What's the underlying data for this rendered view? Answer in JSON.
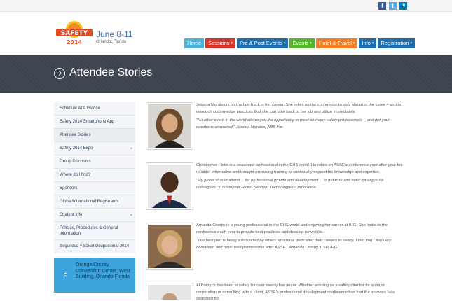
{
  "colors": {
    "nav_blue": "#1f6fae",
    "nav_teal": "#4fb0d8",
    "nav_red": "#d8342c",
    "nav_green": "#55b52e",
    "nav_orange": "#ef7d29",
    "banner": "#3c434d",
    "location_box": "#3ba3dc"
  },
  "social": {
    "items": [
      {
        "name": "facebook-icon",
        "glyph": "f",
        "color": "#3b5998"
      },
      {
        "name": "twitter-icon",
        "glyph": "t",
        "color": "#55acee"
      },
      {
        "name": "linkedin-icon",
        "glyph": "in",
        "color": "#0077b5"
      }
    ]
  },
  "header": {
    "logo_text": "SAFETY",
    "logo_year": "2014",
    "date": "June 8-11",
    "location": "Orlando, Florida"
  },
  "nav": {
    "items": [
      {
        "label": "Home",
        "has_menu": false,
        "color": "#4fb0d8"
      },
      {
        "label": "Sessions",
        "has_menu": true,
        "color": "#d8342c"
      },
      {
        "label": "Pre & Post Events",
        "has_menu": true,
        "color": "#1f6fae"
      },
      {
        "label": "Events",
        "has_menu": true,
        "color": "#55b52e"
      },
      {
        "label": "Hotel & Travel",
        "has_menu": true,
        "color": "#ef7d29"
      },
      {
        "label": "Info",
        "has_menu": true,
        "color": "#1f6fae"
      },
      {
        "label": "Registration",
        "has_menu": true,
        "color": "#1f6fae"
      }
    ]
  },
  "banner": {
    "title": "Attendee Stories"
  },
  "sidebar": {
    "items": [
      {
        "label": "Schedule At A Glance",
        "has_submenu": false
      },
      {
        "label": "Safety 2014 Smartphone App",
        "has_submenu": false
      },
      {
        "label": "Attendee Stories",
        "has_submenu": false
      },
      {
        "label": "Safety 2014 Expo",
        "has_submenu": true
      },
      {
        "label": "Group Discounts",
        "has_submenu": false
      },
      {
        "label": "Where do I find?",
        "has_submenu": false
      },
      {
        "label": "Sponsors",
        "has_submenu": false
      },
      {
        "label": "Global/International Registrants",
        "has_submenu": false
      },
      {
        "label": "Student Info",
        "has_submenu": true
      },
      {
        "label": "Policies, Procedures & General Information",
        "has_submenu": false
      },
      {
        "label": "Seguridad y Salud Ocupacional 2014",
        "has_submenu": false
      }
    ],
    "location": "Orange County Convention Center, West Building, Orlando Florida"
  },
  "stories": [
    {
      "text": "Jessica Morales is on the fast-track in her career. She relies on the conference to stay ahead of the curve – and to research cutting-edge practices that she can take back to her job and utilize immediately.",
      "quote": "“No other event in the world allows you the opportunity to meet so many safety professionals – and get your questions answered!” Jessica Morales, ABB Inc."
    },
    {
      "text": "Christopher Hicks is a seasoned professional in the EHS world. He relies on ASSE’s conference year after year for reliable, informative and thought-provoking training to continually expand his knowledge and expertise.",
      "quote": "“My peers should attend… for professional growth and development… to network and build synergy with colleagues.” Christopher Hicks, Sentient Technologies Corporation"
    },
    {
      "text": "Amanda Crosby is a young professional in the EHS world and enjoying her career at IHG. She looks to the conference each year to provide best practices and develop new skills.",
      "quote": "“The best part is being surrounded by others who have dedicated their careers to safety. I find that I feel very revitalized and refocused professional after ASSE.” Amanda Crosby, CSP, IHG"
    },
    {
      "text": "Al Borzych has been in safety for over twenty five years. Whether working as a safety director for a major corporation or consulting with a client, ASSE’s professional development conference has had the answers he’s searched for.",
      "quote": ""
    }
  ]
}
